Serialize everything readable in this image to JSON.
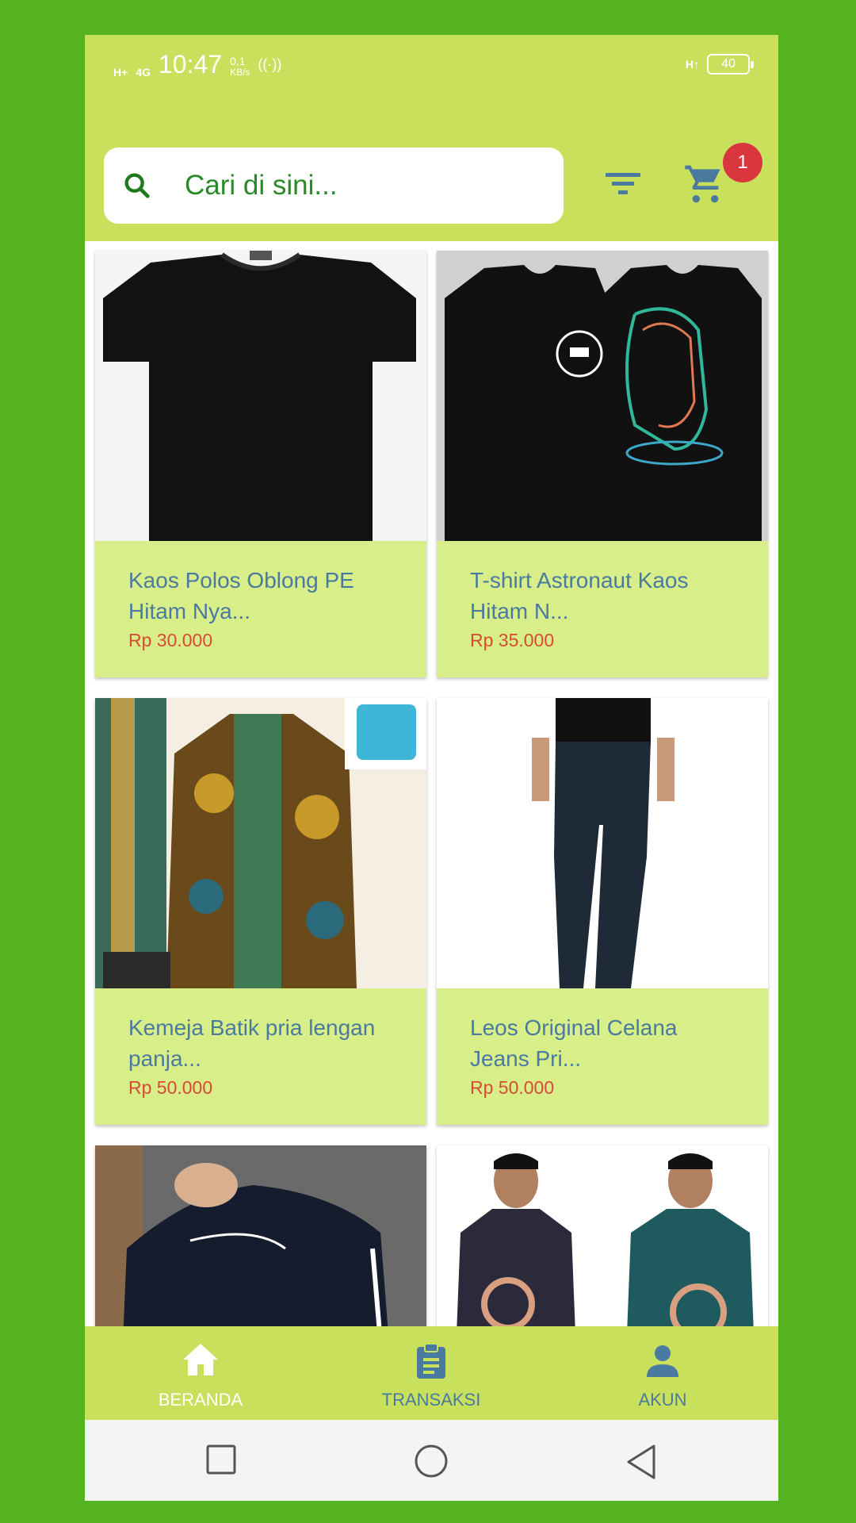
{
  "status_bar": {
    "signal_1": "H+",
    "signal_2": "4G",
    "time": "10:47",
    "speed_value": "0,1",
    "speed_unit": "KB/s",
    "hotspot_icon": "hotspot-icon",
    "network_right": "H↑",
    "battery": "40"
  },
  "search": {
    "placeholder": "Cari di sini..."
  },
  "cart": {
    "badge_count": "1"
  },
  "colors": {
    "background": "#55b320",
    "app_bar": "#c9e05c",
    "card_info": "#d8ee88",
    "product_name": "#4a7aa0",
    "price": "#d84a35",
    "badge": "#d9363e"
  },
  "products": [
    {
      "name_line1": "Kaos Polos Oblong PE",
      "name_line2": "Hitam Nya...",
      "price": "Rp 30.000",
      "image": "black-tshirt"
    },
    {
      "name_line1": "T-shirt Astronaut Kaos",
      "name_line2": "Hitam N...",
      "price": "Rp 35.000",
      "image": "astronaut-tshirt"
    },
    {
      "name_line1": "Kemeja Batik pria lengan",
      "name_line2": "panja...",
      "price": "Rp 50.000",
      "image": "batik-shirt"
    },
    {
      "name_line1": "Leos Original Celana",
      "name_line2": "Jeans Pri...",
      "price": "Rp 50.000",
      "image": "jeans"
    },
    {
      "image": "navy-sweater"
    },
    {
      "image": "batik-shirts-two-models"
    }
  ],
  "bottom_nav": {
    "home_label": "BERANDA",
    "transactions_label": "TRANSAKSI",
    "account_label": "AKUN"
  }
}
